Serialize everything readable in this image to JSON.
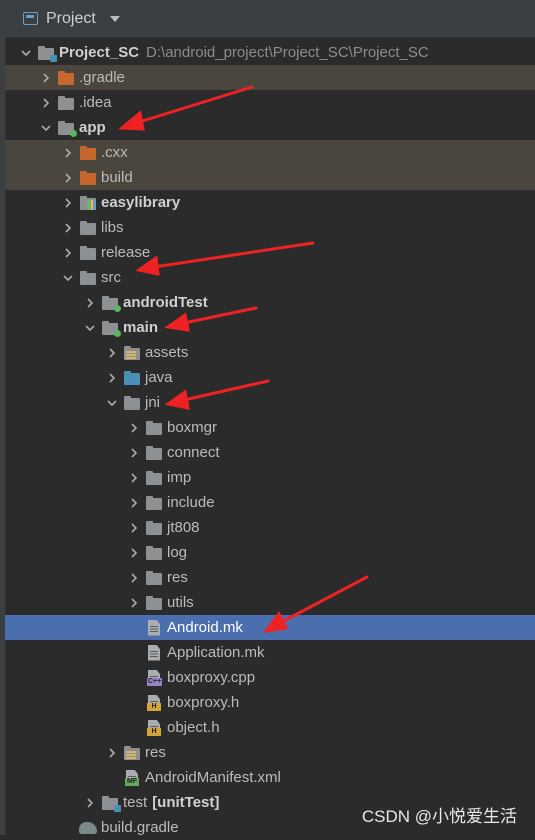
{
  "header": {
    "title": "Project"
  },
  "tree": {
    "project_sc": {
      "name": "Project_SC",
      "path": "D:\\android_project\\Project_SC\\Project_SC"
    },
    "gradle_dir": {
      "name": ".gradle"
    },
    "idea": {
      "name": ".idea"
    },
    "app": {
      "name": "app"
    },
    "cxx": {
      "name": ".cxx"
    },
    "build": {
      "name": "build"
    },
    "easylibrary": {
      "name": "easylibrary"
    },
    "libs": {
      "name": "libs"
    },
    "release": {
      "name": "release"
    },
    "src": {
      "name": "src"
    },
    "androidtest": {
      "name": "androidTest"
    },
    "main": {
      "name": "main"
    },
    "assets": {
      "name": "assets"
    },
    "java": {
      "name": "java"
    },
    "jni": {
      "name": "jni"
    },
    "boxmgr": {
      "name": "boxmgr"
    },
    "connect": {
      "name": "connect"
    },
    "imp": {
      "name": "imp"
    },
    "include": {
      "name": "include"
    },
    "jt808": {
      "name": "jt808"
    },
    "log": {
      "name": "log"
    },
    "res_jni": {
      "name": "res"
    },
    "utils": {
      "name": "utils"
    },
    "android_mk": {
      "name": "Android.mk"
    },
    "application_mk": {
      "name": "Application.mk"
    },
    "boxproxy_cpp": {
      "name": "boxproxy.cpp",
      "badge": "C++"
    },
    "boxproxy_h": {
      "name": "boxproxy.h",
      "badge": "H"
    },
    "object_h": {
      "name": "object.h",
      "badge": "H"
    },
    "res_main": {
      "name": "res"
    },
    "manifest": {
      "name": "AndroidManifest.xml",
      "badge": "MF"
    },
    "test": {
      "name": "test",
      "suffix": "[unitTest]"
    },
    "build_gradle": {
      "name": "build.gradle"
    }
  },
  "watermark": "CSDN @小悦爱生活",
  "colors": {
    "background": "#2b2b2b",
    "selection": "#4b6eaf",
    "excluded_row": "#4a463d",
    "folder_orange": "#c6682d",
    "folder_blue": "#4a8fb5",
    "annotation_arrow": "#ee2222"
  }
}
